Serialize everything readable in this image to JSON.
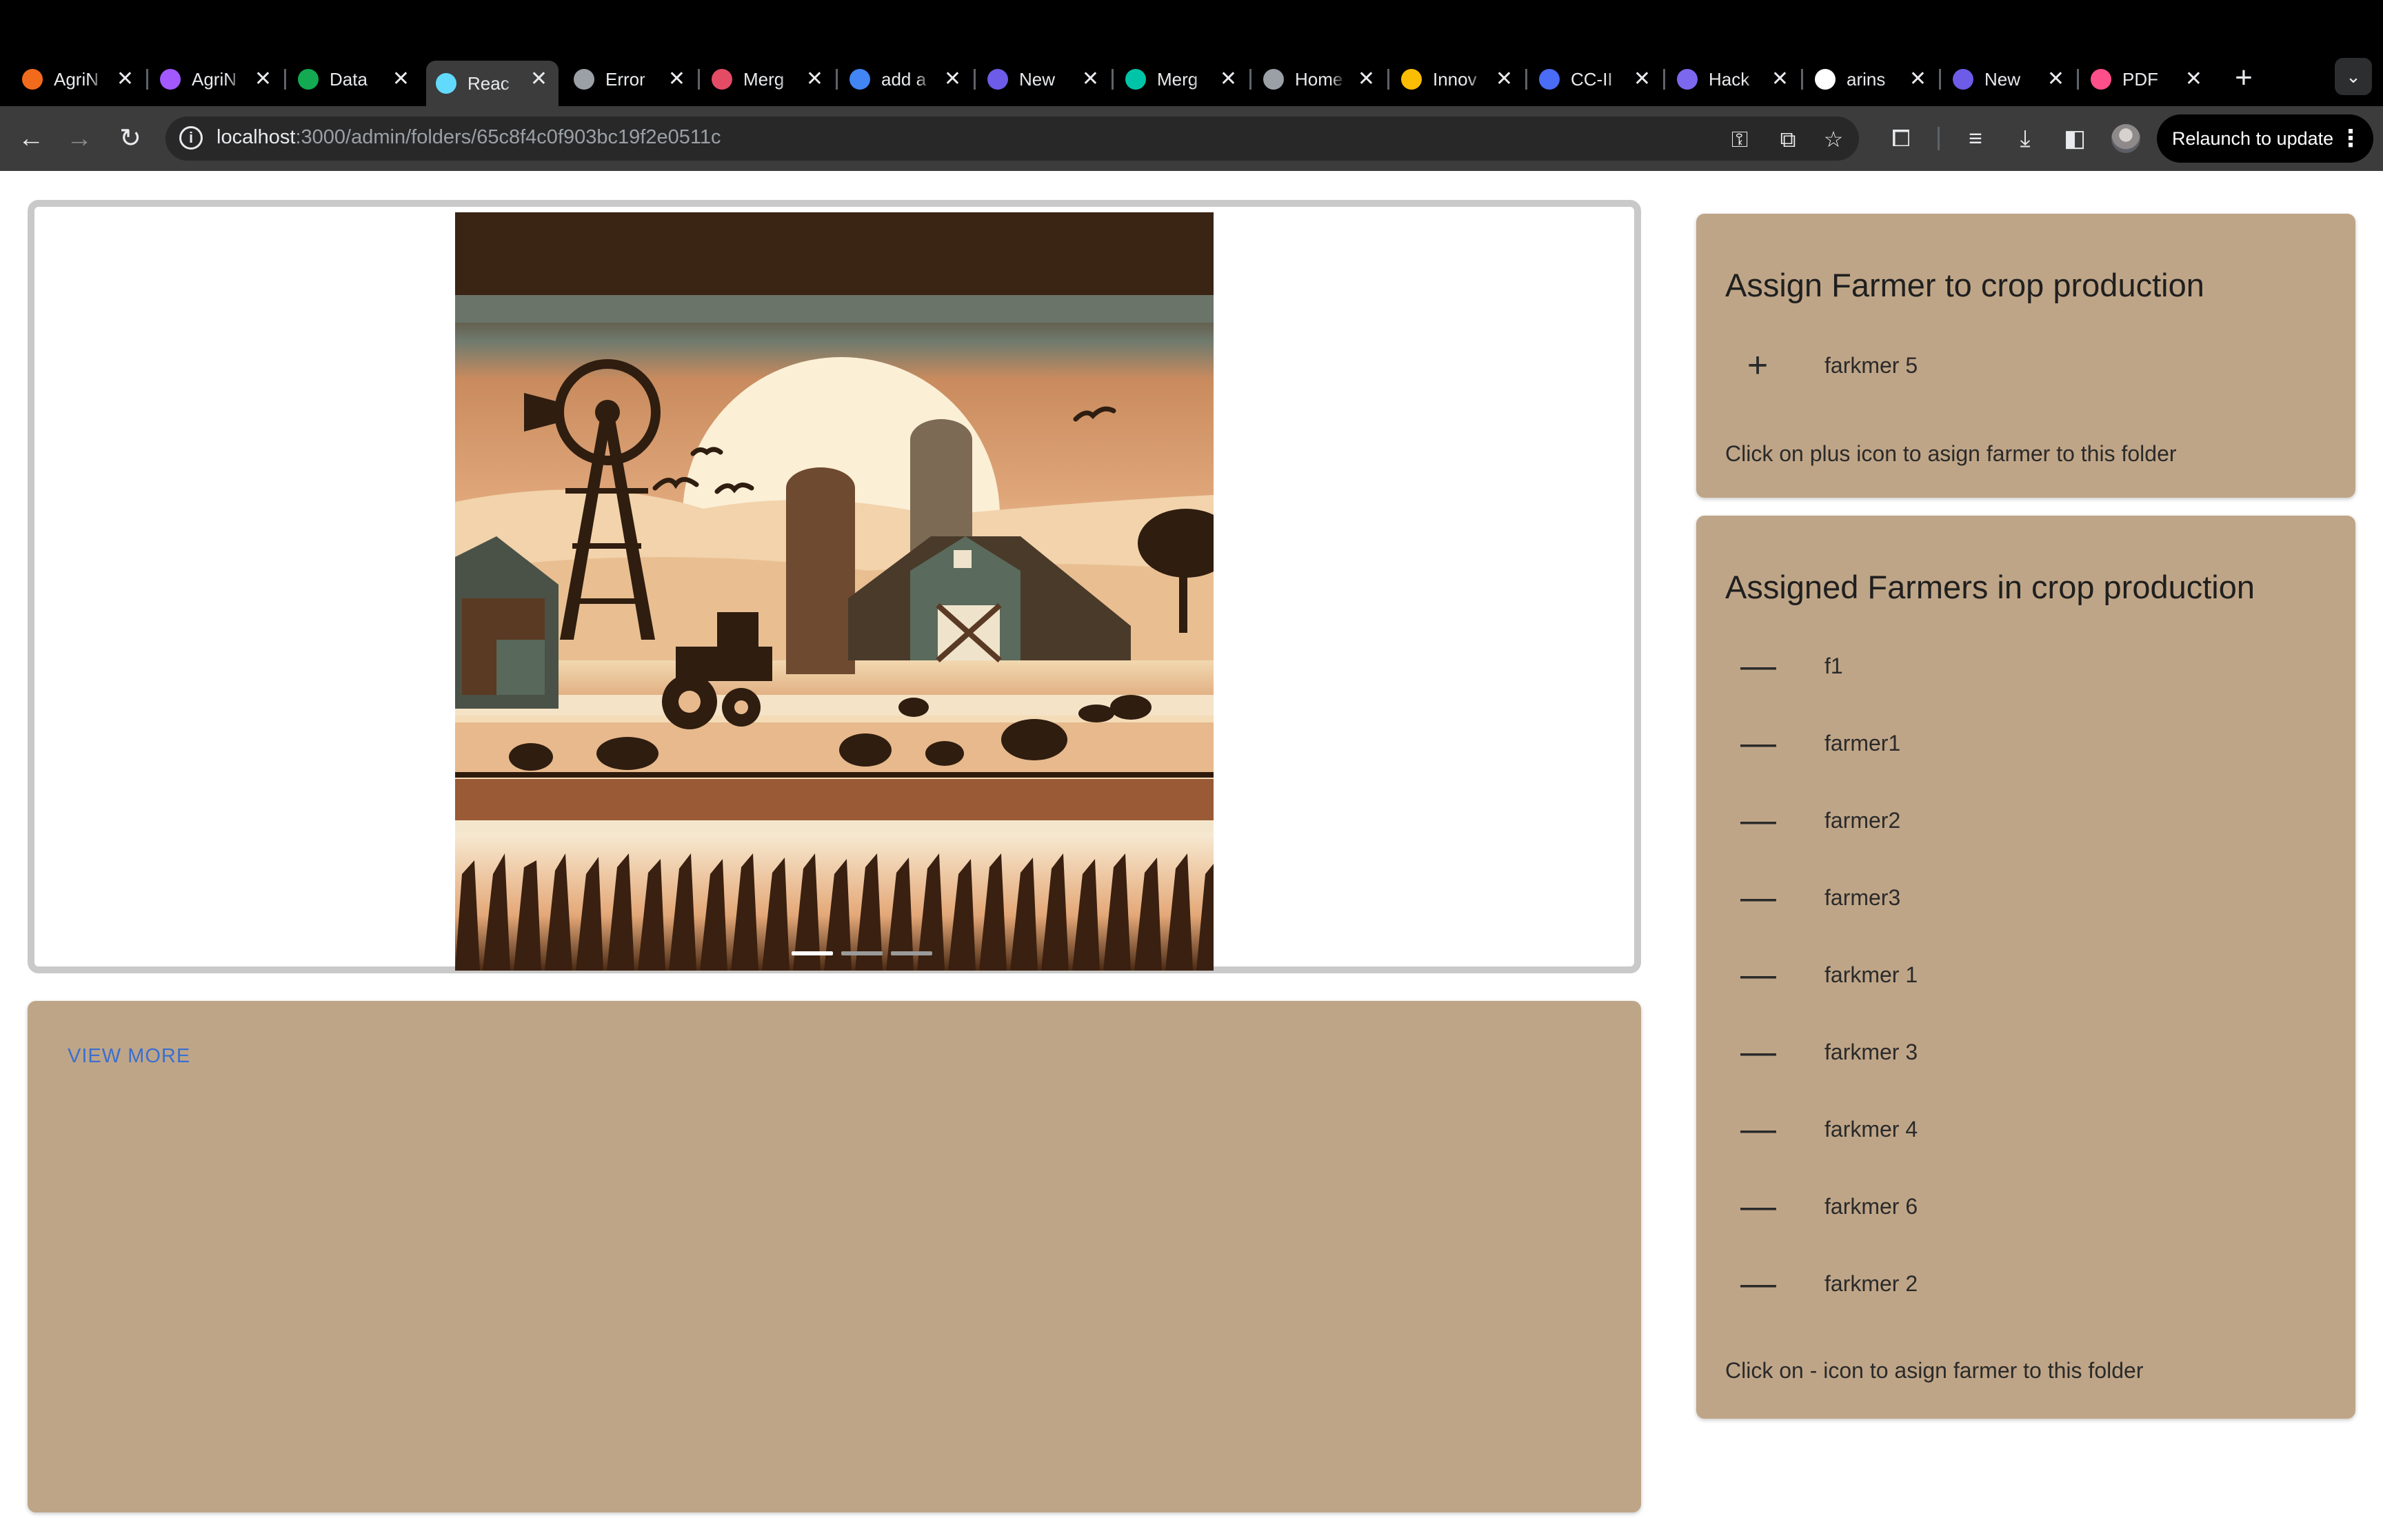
{
  "browser": {
    "tabs": [
      {
        "title": "AgriN",
        "favicon_color": "#f26b1d",
        "active": false
      },
      {
        "title": "AgriN",
        "favicon_color": "#a259ff",
        "active": false
      },
      {
        "title": "Data",
        "favicon_color": "#13aa52",
        "active": false
      },
      {
        "title": "Reac",
        "favicon_color": "#61dafb",
        "active": true
      },
      {
        "title": "Error",
        "favicon_color": "#9aa0a6",
        "active": false
      },
      {
        "title": "Merg",
        "favicon_color": "#e44c65",
        "active": false
      },
      {
        "title": "add a",
        "favicon_color": "#4285f4",
        "active": false
      },
      {
        "title": "New",
        "favicon_color": "#6c5ce7",
        "active": false
      },
      {
        "title": "Merg",
        "favicon_color": "#00c4a7",
        "active": false
      },
      {
        "title": "Home",
        "favicon_color": "#9aa0a6",
        "active": false
      },
      {
        "title": "Innov",
        "favicon_color": "#fbbc04",
        "active": false
      },
      {
        "title": "CC-II",
        "favicon_color": "#4a6cf7",
        "active": false
      },
      {
        "title": "Hack",
        "favicon_color": "#7b68ee",
        "active": false
      },
      {
        "title": "arins",
        "favicon_color": "#ffffff",
        "active": false
      },
      {
        "title": "New",
        "favicon_color": "#6c5ce7",
        "active": false
      },
      {
        "title": "PDF",
        "favicon_color": "#ff4f8b",
        "active": false
      }
    ],
    "tab_close_glyph": "✕",
    "new_tab_glyph": "+",
    "url_host": "localhost",
    "url_path": ":3000/admin/folders/65c8f4c0f903bc19f2e0511c",
    "relaunch_label": "Relaunch to update"
  },
  "carousel": {
    "image_alt": "Illustrated farm scene with windmill, silos, barns, tractor, sheep and wheat field",
    "slide_count": 3,
    "active_slide": 1
  },
  "details": {
    "view_more_label": "VIEW MORE"
  },
  "assign_panel": {
    "title": "Assign Farmer to crop production",
    "add_icon": "+",
    "items": [
      "farkmer 5"
    ],
    "hint": "Click on plus icon to asign farmer to this folder"
  },
  "assigned_panel": {
    "title": "Assigned Farmers in crop production",
    "remove_icon": "—",
    "items": [
      "f1",
      "farmer1",
      "farmer2",
      "farmer3",
      "farkmer 1",
      "farkmer 3",
      "farkmer 4",
      "farkmer 6",
      "farkmer 2"
    ],
    "hint": "Click on - icon to asign farmer to this folder"
  },
  "colors": {
    "panel_bg": "#bfa587",
    "link": "#3a6fd0",
    "chrome_bg": "#000000",
    "toolbar_bg": "#3c3c3c"
  }
}
